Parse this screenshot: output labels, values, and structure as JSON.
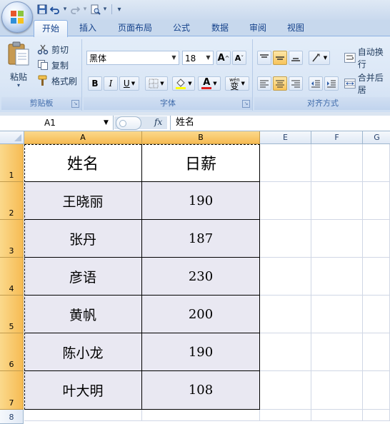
{
  "quick_access": {
    "dropdown_glyph": "▾"
  },
  "tabs": [
    {
      "label": "开始",
      "active": true
    },
    {
      "label": "插入"
    },
    {
      "label": "页面布局"
    },
    {
      "label": "公式"
    },
    {
      "label": "数据"
    },
    {
      "label": "审阅"
    },
    {
      "label": "视图"
    }
  ],
  "clipboard": {
    "paste_label": "粘贴",
    "cut_label": "剪切",
    "copy_label": "复制",
    "format_painter_label": "格式刷",
    "group_label": "剪贴板"
  },
  "font": {
    "font_name": "黑体",
    "font_size": "18",
    "bold": "B",
    "italic": "I",
    "underline": "U",
    "font_color_glyph": "A",
    "phonetic_glyph": "wén",
    "phonetic_char": "变",
    "group_label": "字体"
  },
  "alignment": {
    "wrap_text_label": "自动换行",
    "merge_label": "合并后居",
    "group_label": "对齐方式"
  },
  "formula_bar": {
    "name_box": "A1",
    "fx": "fx",
    "content": "姓名"
  },
  "columns": [
    "A",
    "B",
    "E",
    "F",
    "G"
  ],
  "rows": [
    "1",
    "2",
    "3",
    "4",
    "5",
    "6",
    "7",
    "8"
  ],
  "table": {
    "headers": [
      "姓名",
      "日薪"
    ],
    "rows": [
      [
        "王晓丽",
        "190"
      ],
      [
        "张丹",
        "187"
      ],
      [
        "彦语",
        "230"
      ],
      [
        "黄帆",
        "200"
      ],
      [
        "陈小龙",
        "190"
      ],
      [
        "叶大明",
        "108"
      ]
    ]
  },
  "colors": {
    "selection_header": "#f6bb53",
    "data_fill": "#e9e8f2",
    "ribbon_bg": "#dbe7f6"
  }
}
